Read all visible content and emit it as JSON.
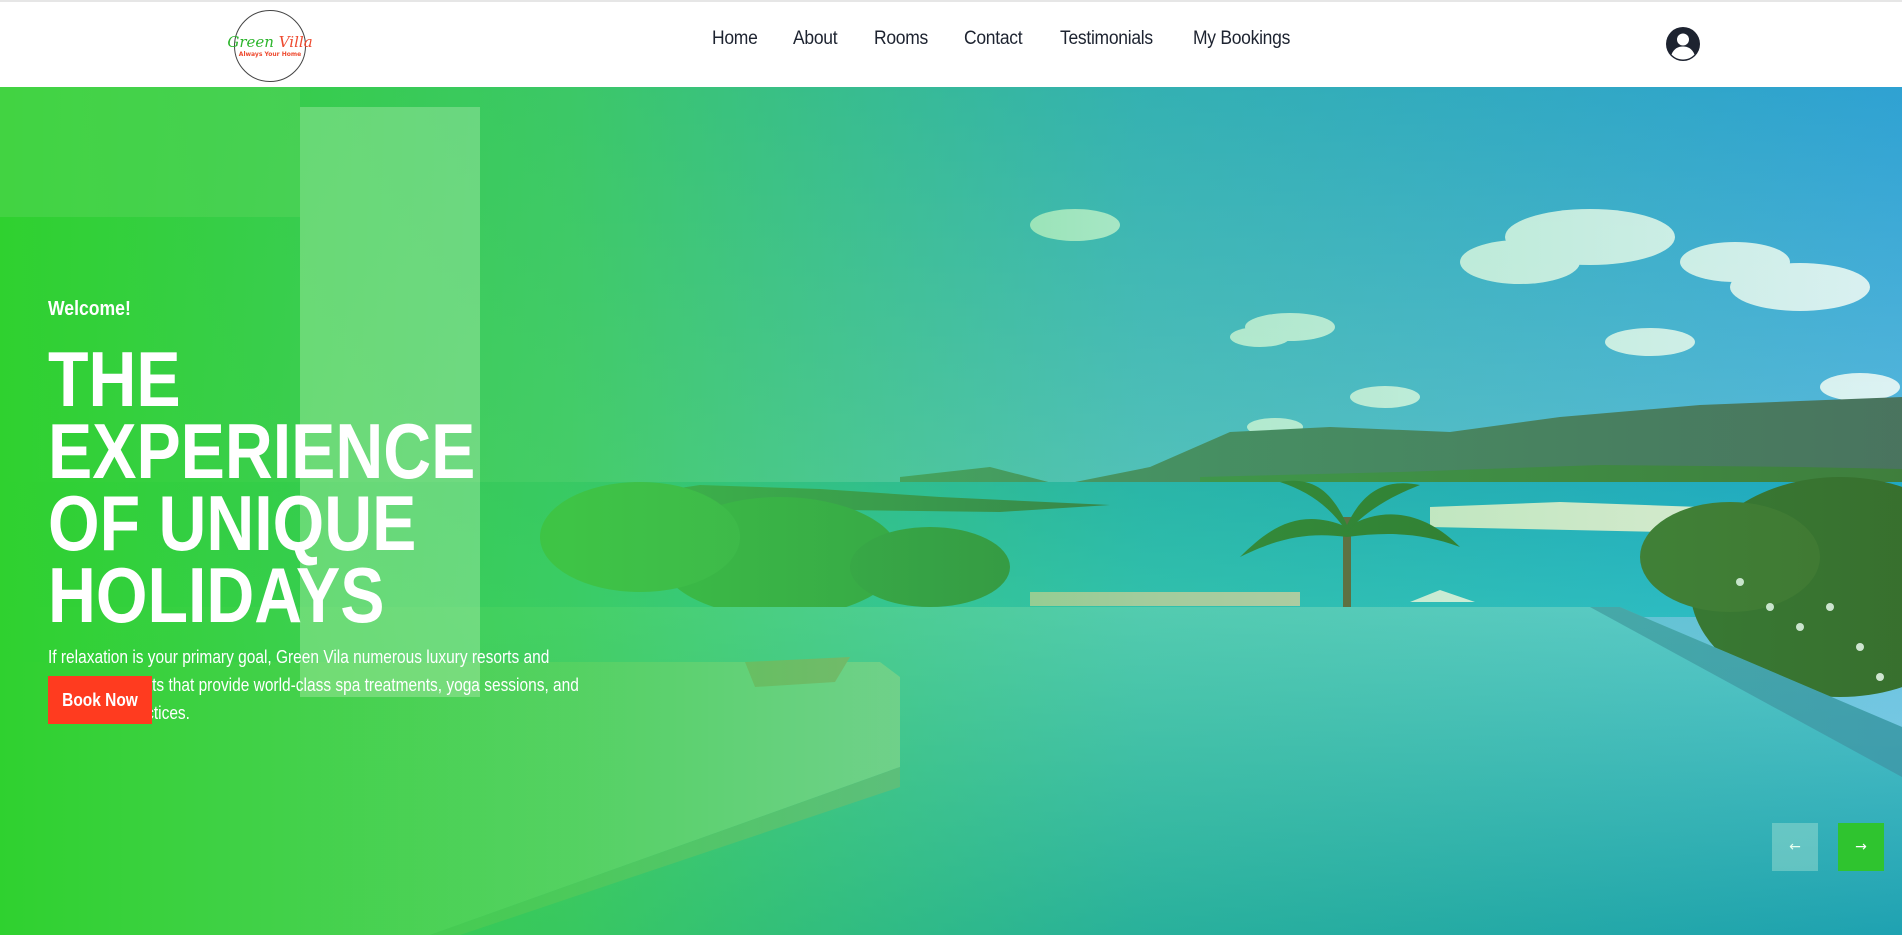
{
  "brand": {
    "logo_word1": "Green",
    "logo_word2": "Villa",
    "logo_tagline": "Always Your Home"
  },
  "nav": {
    "items": [
      "Home",
      "About",
      "Rooms",
      "Contact",
      "Testimonials",
      "My Bookings"
    ]
  },
  "icons": {
    "user": "user-circle-icon",
    "prev": "arrow-left-icon",
    "next": "arrow-right-icon"
  },
  "hero": {
    "welcome": "Welcome!",
    "headline_lines": [
      "THE EXPERIENCE",
      "OF UNIQUE",
      "HOLIDAYS"
    ],
    "description": "If relaxation is your primary goal, Green Vila numerous luxury resorts and wellness retreats that provide world-class spa treatments, yoga sessions, and meditation practices.",
    "cta": "Book Now",
    "prev_symbol": "←",
    "next_symbol": "→"
  },
  "colors": {
    "accent_green": "#2fc42f",
    "cta_red": "#ff3b1f",
    "nav_text": "#1d2330"
  }
}
